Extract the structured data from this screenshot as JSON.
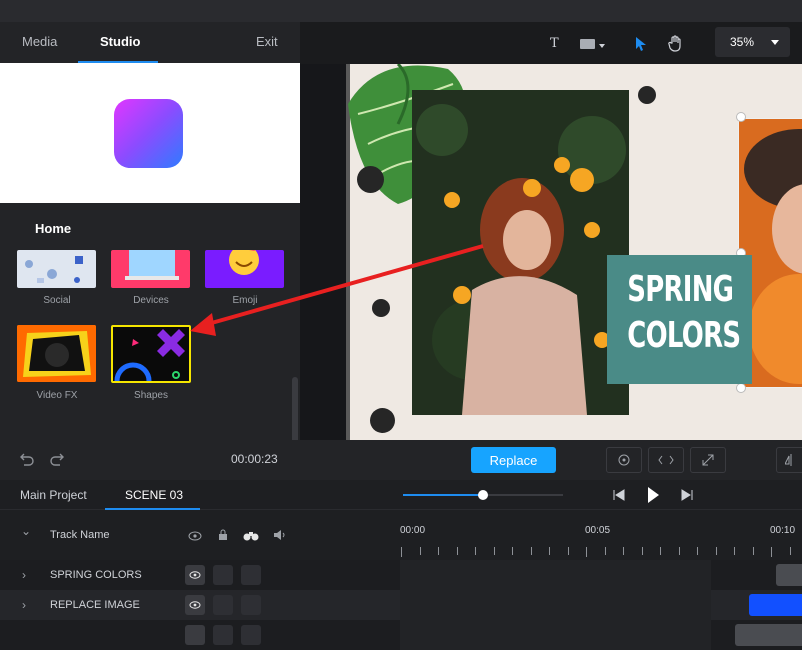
{
  "left_panel": {
    "tabs": [
      {
        "label": "Media",
        "active": false
      },
      {
        "label": "Studio",
        "active": true
      },
      {
        "label": "Exit",
        "active": false
      }
    ],
    "section_title": "Home",
    "grid": [
      {
        "label": "Social",
        "icon": "social-thumb"
      },
      {
        "label": "Devices",
        "icon": "devices-thumb"
      },
      {
        "label": "Emoji",
        "icon": "emoji-thumb"
      },
      {
        "label": "Video FX",
        "icon": "videofx-thumb"
      },
      {
        "label": "Shapes",
        "icon": "shapes-thumb",
        "selected": true
      }
    ]
  },
  "toolbar": {
    "text_tool": "T",
    "zoom_value": "35%"
  },
  "canvas": {
    "title_line1": "SPRING",
    "title_line2": "COLORS"
  },
  "controls": {
    "time": "00:00:23",
    "replace_label": "Replace"
  },
  "timeline": {
    "tabs": [
      {
        "label": "Main Project",
        "active": false
      },
      {
        "label": "SCENE 03",
        "active": true
      }
    ],
    "header_label": "Track Name",
    "ruler": [
      "00:00",
      "00:05",
      "00:10"
    ],
    "tracks": [
      {
        "name": "SPRING COLORS"
      },
      {
        "name": "REPLACE IMAGE"
      }
    ]
  },
  "colors": {
    "accent": "#1e8cf0",
    "replace_button": "#17a4ff",
    "title_box": "#4a8b87",
    "arrow": "#e82020"
  }
}
